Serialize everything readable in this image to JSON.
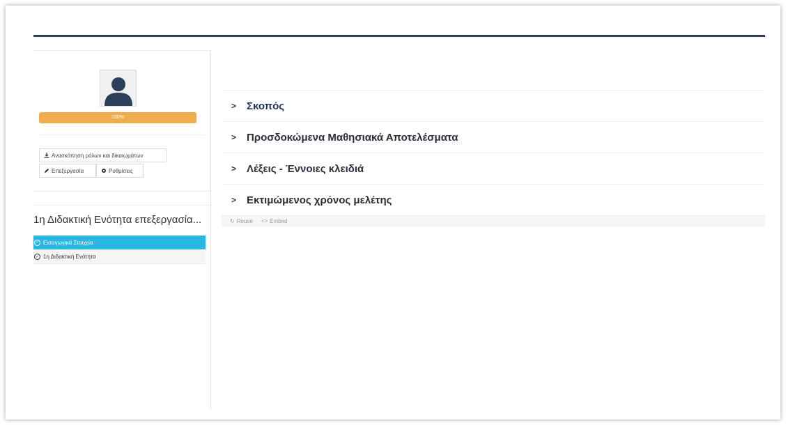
{
  "profile": {
    "progress_label": "100%",
    "progress_value": 100,
    "overview_button": "Ανασκόπηση ρόλων και δικαιωμάτων",
    "edit_button": "Επεξεργασία",
    "settings_button": "Ρυθμίσεις"
  },
  "unit": {
    "title": "1η Διδακτική Ενότητα επεξεργασία...",
    "items": [
      {
        "label": "Εισαγωγικά Στοιχεία",
        "active": true
      },
      {
        "label": "1η Διδακτική Ενότητα",
        "active": false
      }
    ]
  },
  "accordion": [
    {
      "title": "Σκοπός"
    },
    {
      "title": "Προσδοκώμενα Μαθησιακά Αποτελέσματα"
    },
    {
      "title": "Λέξεις - Έννοιες κλειδιά"
    },
    {
      "title": "Εκτιμώμενος χρόνος μελέτης"
    }
  ],
  "actions": {
    "reuse": "Reuse",
    "embed": "Embed"
  },
  "colors": {
    "topbar": "#2c3e5a",
    "progress": "#f0ad4e",
    "active_item": "#29b6e0",
    "accordion_primary": "#23325e"
  },
  "icons": {
    "avatar": "user-silhouette-icon",
    "overview": "download-icon",
    "edit": "pencil-icon",
    "settings": "gear-icon",
    "unit_item": "check-circle-icon",
    "accordion": "chevron-right-icon",
    "reuse": "refresh-icon",
    "embed": "code-icon"
  }
}
